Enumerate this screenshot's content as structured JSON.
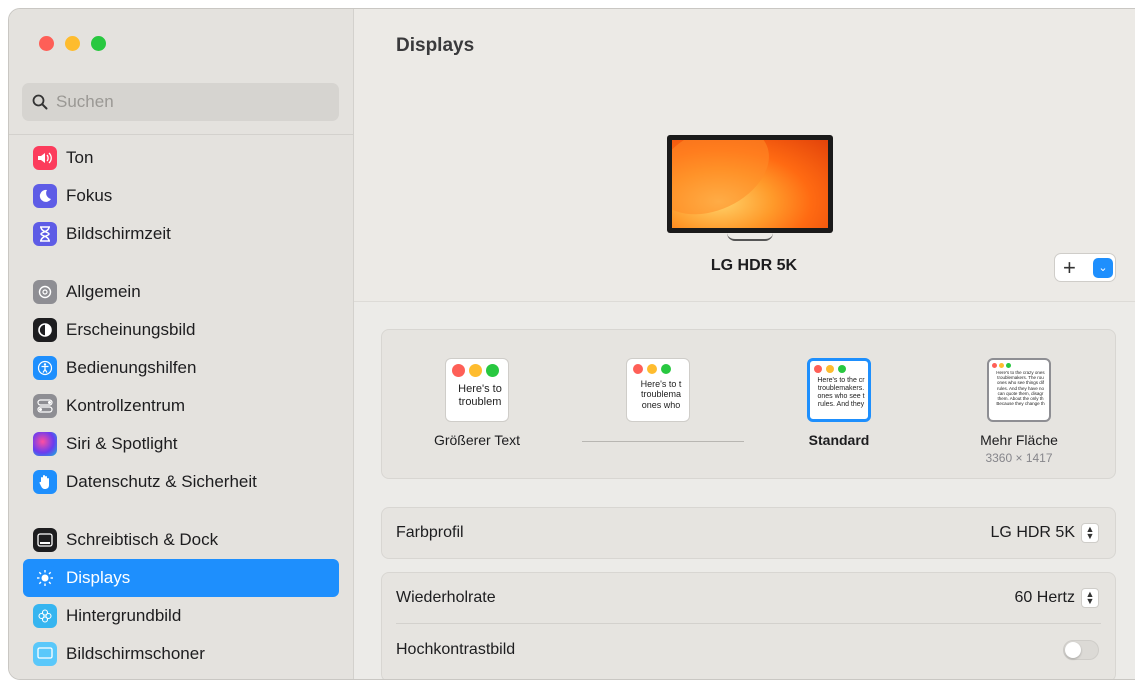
{
  "window": {
    "traffic_lights": [
      "close",
      "minimize",
      "zoom"
    ]
  },
  "search": {
    "placeholder": "Suchen"
  },
  "sidebar": {
    "items": [
      {
        "label": "Ton",
        "icon": "speaker-icon",
        "color": "#fc3c5c"
      },
      {
        "label": "Fokus",
        "icon": "moon-icon",
        "color": "#5e5ce6"
      },
      {
        "label": "Bildschirmzeit",
        "icon": "hourglass-icon",
        "color": "#5e5ce6"
      },
      {
        "label": "Allgemein",
        "icon": "gear-icon",
        "color": "#8e8e93"
      },
      {
        "label": "Erscheinungsbild",
        "icon": "appearance-icon",
        "color": "#1d1d1f"
      },
      {
        "label": "Bedienungshilfen",
        "icon": "accessibility-icon",
        "color": "#1e8ffd"
      },
      {
        "label": "Kontrollzentrum",
        "icon": "toggles-icon",
        "color": "#8e8e93"
      },
      {
        "label": "Siri & Spotlight",
        "icon": "siri-icon",
        "color": "#5a3fa8"
      },
      {
        "label": "Datenschutz & Sicherheit",
        "icon": "hand-icon",
        "color": "#1e8ffd"
      },
      {
        "label": "Schreibtisch & Dock",
        "icon": "dock-icon",
        "color": "#1d1d1f"
      },
      {
        "label": "Displays",
        "icon": "sun-icon",
        "color": "#1e8ffd",
        "active": true
      },
      {
        "label": "Hintergrundbild",
        "icon": "flower-icon",
        "color": "#36b5f0"
      },
      {
        "label": "Bildschirmschoner",
        "icon": "screensaver-icon",
        "color": "#5ac8fa"
      }
    ]
  },
  "main": {
    "title": "Displays",
    "monitor_name": "LG HDR 5K",
    "add_button": "+",
    "resolution_options": [
      {
        "label": "Größerer Text",
        "sample": [
          "Here's to",
          "troublem"
        ],
        "selected": false
      },
      {
        "label": "",
        "sample": [
          "Here's to t",
          "troublema",
          "ones who"
        ],
        "selected": false
      },
      {
        "label": "Standard",
        "sample": [
          "Here's to the cr",
          "troublemakers.",
          "ones who see t",
          "rules. And they"
        ],
        "selected": true
      },
      {
        "label": "Mehr Fläche",
        "sublabel": "3360 × 1417",
        "sample": [
          "Here's to the crazy ones",
          "troublemakers. The rou",
          "ones who see things dif",
          "rules. And they have no",
          "can quote them, disagr",
          "them. About the only th",
          "Because they change th"
        ],
        "selected": false
      }
    ],
    "color_profile": {
      "label": "Farbprofil",
      "value": "LG HDR 5K"
    },
    "refresh_rate": {
      "label": "Wiederholrate",
      "value": "60 Hertz"
    },
    "high_contrast": {
      "label": "Hochkontrastbild",
      "enabled": false
    }
  }
}
